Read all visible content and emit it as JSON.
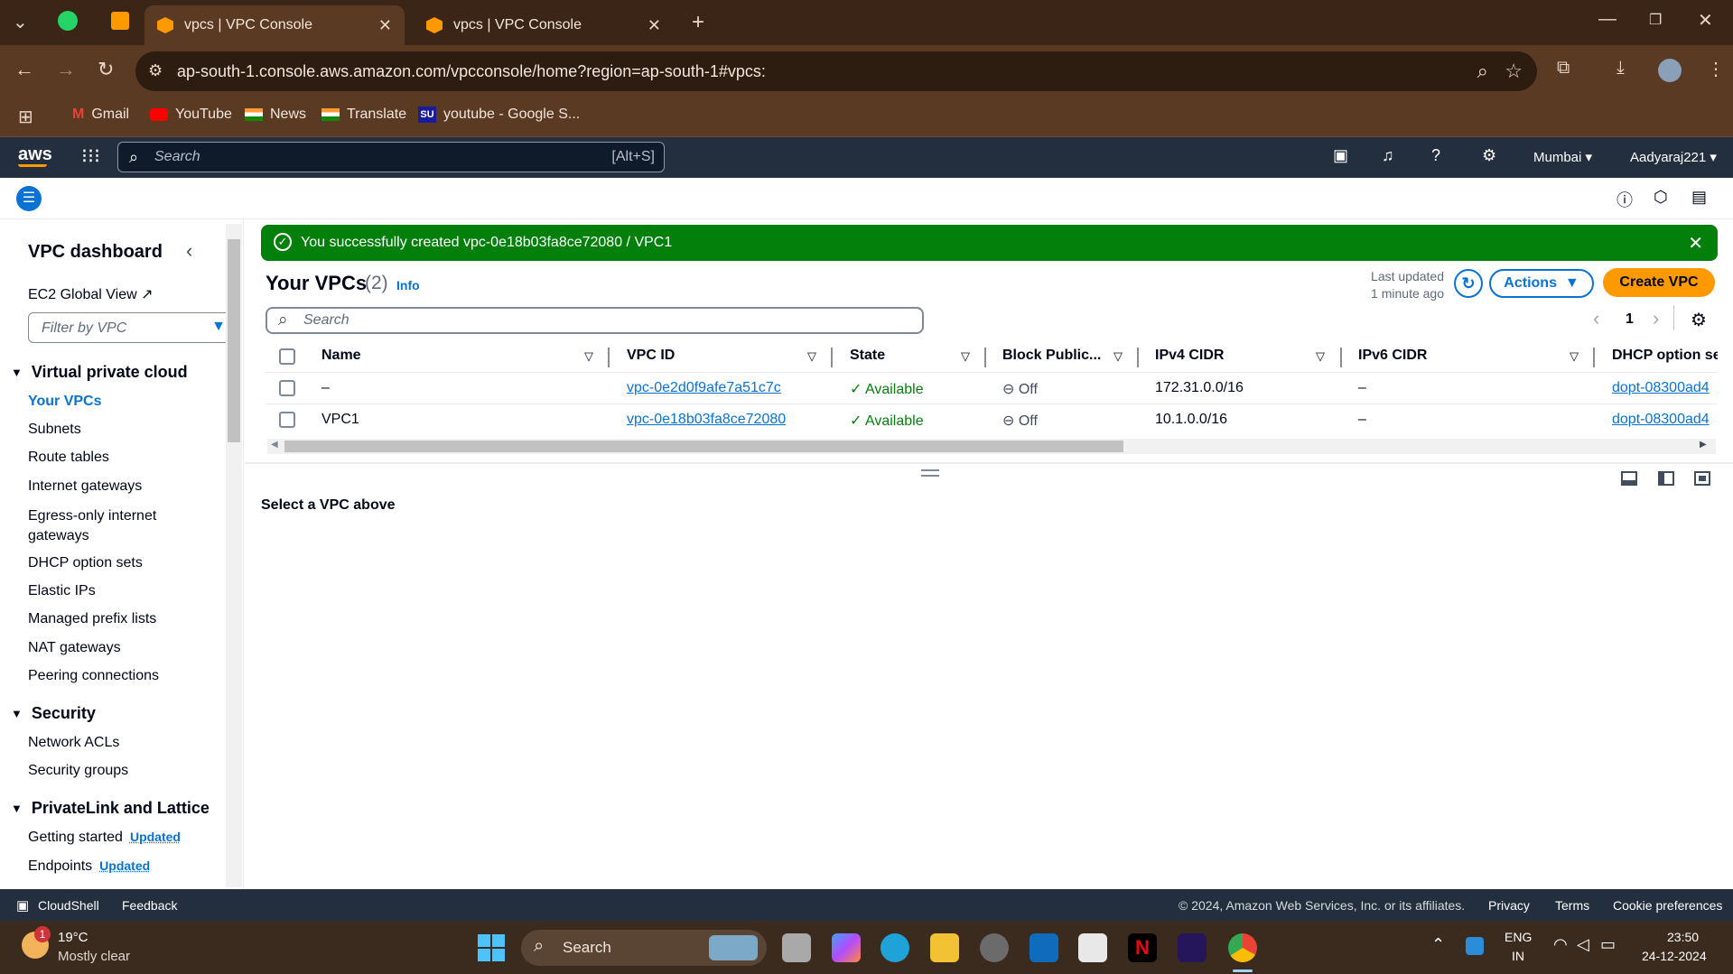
{
  "browser": {
    "tabs": [
      {
        "title": "vpcs | VPC Console",
        "active": true
      },
      {
        "title": "vpcs | VPC Console",
        "active": false
      }
    ],
    "url": "ap-south-1.console.aws.amazon.com/vpcconsole/home?region=ap-south-1#vpcs:",
    "bookmarks": [
      "Gmail",
      "YouTube",
      "News",
      "Translate",
      "youtube - Google S..."
    ]
  },
  "aws_nav": {
    "logo": "aws",
    "search_placeholder": "Search",
    "search_hint": "[Alt+S]",
    "region": "Mumbai ▾",
    "user": "Aadyaraj221 ▾"
  },
  "sidebar": {
    "title": "VPC dashboard",
    "ec2_global": "EC2 Global View",
    "filter_placeholder": "Filter by VPC",
    "sections": [
      {
        "title": "Virtual private cloud",
        "items": [
          "Your VPCs",
          "Subnets",
          "Route tables",
          "Internet gateways",
          "Egress-only internet gateways",
          "DHCP option sets",
          "Elastic IPs",
          "Managed prefix lists",
          "NAT gateways",
          "Peering connections"
        ]
      },
      {
        "title": "Security",
        "items": [
          "Network ACLs",
          "Security groups"
        ]
      },
      {
        "title": "PrivateLink and Lattice",
        "items": [
          "Getting started",
          "Endpoints"
        ]
      }
    ],
    "updated_badge": "Updated"
  },
  "flash": {
    "message": "You successfully created vpc-0e18b03fa8ce72080 / VPC1"
  },
  "main": {
    "heading": "Your VPCs",
    "count": "(2)",
    "info": "Info",
    "last_updated_line1": "Last updated",
    "last_updated_line2": "1 minute ago",
    "actions_label": "Actions",
    "create_label": "Create VPC",
    "search_placeholder": "Search",
    "page": "1",
    "columns": [
      "Name",
      "VPC ID",
      "State",
      "Block Public...",
      "IPv4 CIDR",
      "IPv6 CIDR",
      "DHCP option se"
    ],
    "rows": [
      {
        "name": "–",
        "vpc_id": "vpc-0e2d0f9afe7a51c7c",
        "state": "Available",
        "block": "Off",
        "ipv4": "172.31.0.0/16",
        "ipv6": "–",
        "dhcp": "dopt-08300ad4"
      },
      {
        "name": "VPC1",
        "vpc_id": "vpc-0e18b03fa8ce72080",
        "state": "Available",
        "block": "Off",
        "ipv4": "10.1.0.0/16",
        "ipv6": "–",
        "dhcp": "dopt-08300ad4"
      }
    ],
    "detail_text": "Select a VPC above"
  },
  "footer": {
    "cloudshell": "CloudShell",
    "feedback": "Feedback",
    "copyright": "© 2024, Amazon Web Services, Inc. or its affiliates.",
    "privacy": "Privacy",
    "terms": "Terms",
    "cookies": "Cookie preferences"
  },
  "taskbar": {
    "weather_temp": "19°C",
    "weather_desc": "Mostly clear",
    "weather_badge": "1",
    "search_label": "Search",
    "lang1": "ENG",
    "lang2": "IN",
    "time": "23:50",
    "date": "24-12-2024"
  },
  "colors": {
    "aws_orange": "#ff9900",
    "success_green": "#037f0c",
    "link_blue": "#0972d3",
    "aws_nav": "#232f3e"
  }
}
